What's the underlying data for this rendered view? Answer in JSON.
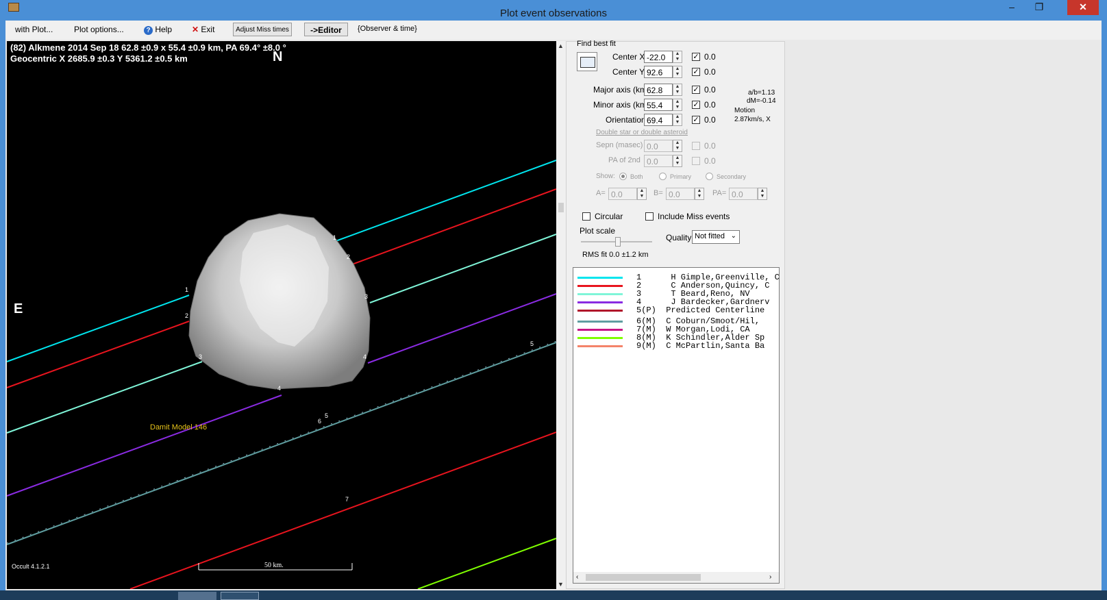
{
  "window": {
    "title": "Plot event observations",
    "minimize": "–",
    "maximize": "❐",
    "close": "✕"
  },
  "menu": {
    "with_plot": "with Plot...",
    "plot_options": "Plot options...",
    "help": "Help",
    "exit": "Exit",
    "adjust_miss_times": "Adjust Miss times",
    "editor": "->Editor",
    "observer_time": "{Observer & time}"
  },
  "plot": {
    "header_line1": "(82) Alkmene  2014 Sep 18  62.8 ±0.9 x 55.4 ±0.9 km, PA 69.4° ±8.0 °",
    "header_line2": "Geocentric  X  2685.9 ±0.3  Y 5361.2 ±0.5 km",
    "north": "N",
    "east": "E",
    "model_label": "Damit Model 146",
    "version": "Occult 4.1.2.1",
    "scale_label": "50 km.",
    "chord_labels": [
      "1",
      "2",
      "3",
      "4",
      "1",
      "2",
      "3",
      "4",
      "5",
      "5",
      "6",
      "7"
    ]
  },
  "fit": {
    "find_best_fit": "Find best fit",
    "center_x_label": "Center X",
    "center_x": "-22.0",
    "center_y_label": "Center Y",
    "center_y": "92.6",
    "major_label": "Major axis (km)",
    "major": "62.8",
    "minor_label": "Minor axis (km)",
    "minor": "55.4",
    "orientation_label": "Orientation",
    "orientation": "69.4",
    "check_value": "0.0",
    "ratio": "a/b=1.13",
    "dm": "dM=-0.14",
    "motion_label": "Motion",
    "motion": "2.87km/s, X",
    "double_label": "Double star  or  double asteroid",
    "sepn_label": "Sepn (masec)",
    "sepn": "0.0",
    "pa2_label": "PA of 2nd",
    "pa2": "0.0",
    "show_label": "Show:",
    "both": "Both",
    "primary": "Primary",
    "secondary": "Secondary",
    "a_label": "A=",
    "a_val": "0.0",
    "b_label": "B=",
    "b_val": "0.0",
    "pa_label": "PA=",
    "pa_val": "0.0",
    "circular": "Circular",
    "include_miss": "Include Miss events",
    "plot_scale": "Plot scale",
    "quality_label": "Quality",
    "quality": "Not fitted",
    "rms": "RMS fit 0.0 ±1.2 km"
  },
  "legend": [
    {
      "text": "1      H Gimple,Greenville, C",
      "color": "#00e5ee"
    },
    {
      "text": "2      C Anderson,Quincy, C",
      "color": "#e8141e"
    },
    {
      "text": "3      T Beard,Reno, NV",
      "color": "#7ff5d8"
    },
    {
      "text": "4      J Bardecker,Gardnerv",
      "color": "#8a2be2"
    },
    {
      "text": "5(P)  Predicted Centerline",
      "color": "#b0142a"
    },
    {
      "text": "6(M)  C Coburn/Smoot/Hil,",
      "color": "#5f9ea0"
    },
    {
      "text": "7(M)  W Morgan,Lodi, CA",
      "color": "#c71585"
    },
    {
      "text": "8(M)  K Schindler,Alder Sp",
      "color": "#7fff00"
    },
    {
      "text": "9(M)  C McPartlin,Santa Ba",
      "color": "#f4846a"
    }
  ]
}
